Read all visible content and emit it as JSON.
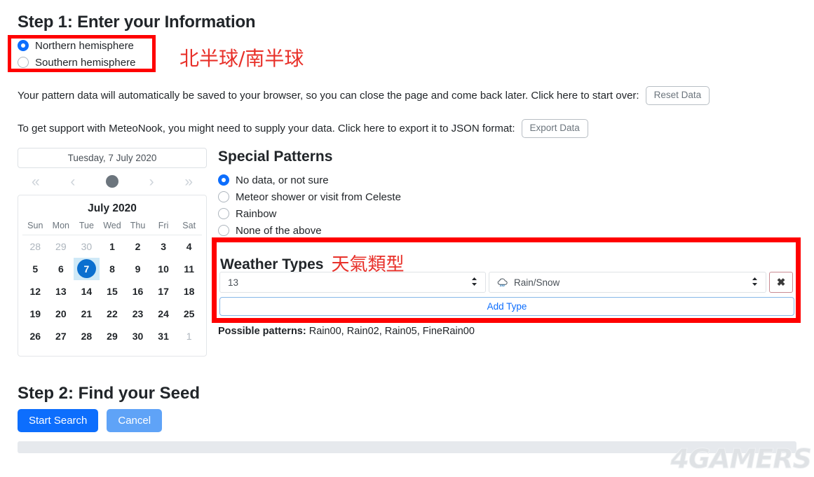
{
  "step1": {
    "title": "Step 1: Enter your Information",
    "hemisphere": {
      "options": [
        {
          "label": "Northern hemisphere",
          "selected": true
        },
        {
          "label": "Southern hemisphere",
          "selected": false
        }
      ],
      "annotation_cn": "北半球/南半球",
      "annotation_color": "#e8312a",
      "highlight_color": "#ff0000"
    },
    "save_notice": {
      "text": "Your pattern data will automatically be saved to your browser, so you can close the page and come back later. Click here to start over:",
      "button": "Reset Data"
    },
    "export_notice": {
      "text": "To get support with MeteoNook, you might need to supply your data. Click here to export it to JSON format:",
      "button": "Export Data"
    }
  },
  "calendar": {
    "selected_date_label": "Tuesday, 7 July 2020",
    "nav": {
      "prev_year_icon": "chevron-double-left",
      "prev_month_icon": "chevron-left",
      "today_icon": "circle-dot",
      "next_month_icon": "chevron-right",
      "next_year_icon": "chevron-double-right"
    },
    "month_title": "July 2020",
    "weekdays": [
      "Sun",
      "Mon",
      "Tue",
      "Wed",
      "Thu",
      "Fri",
      "Sat"
    ],
    "weeks": [
      [
        {
          "d": "28",
          "muted": true
        },
        {
          "d": "29",
          "muted": true
        },
        {
          "d": "30",
          "muted": true
        },
        {
          "d": "1"
        },
        {
          "d": "2"
        },
        {
          "d": "3"
        },
        {
          "d": "4"
        }
      ],
      [
        {
          "d": "5"
        },
        {
          "d": "6"
        },
        {
          "d": "7",
          "selected": true
        },
        {
          "d": "8"
        },
        {
          "d": "9"
        },
        {
          "d": "10"
        },
        {
          "d": "11"
        }
      ],
      [
        {
          "d": "12"
        },
        {
          "d": "13"
        },
        {
          "d": "14"
        },
        {
          "d": "15"
        },
        {
          "d": "16"
        },
        {
          "d": "17"
        },
        {
          "d": "18"
        }
      ],
      [
        {
          "d": "19"
        },
        {
          "d": "20"
        },
        {
          "d": "21"
        },
        {
          "d": "22"
        },
        {
          "d": "23"
        },
        {
          "d": "24"
        },
        {
          "d": "25"
        }
      ],
      [
        {
          "d": "26"
        },
        {
          "d": "27"
        },
        {
          "d": "28"
        },
        {
          "d": "29"
        },
        {
          "d": "30"
        },
        {
          "d": "31"
        },
        {
          "d": "1",
          "muted": true
        }
      ]
    ],
    "selected_day": "7"
  },
  "special_patterns": {
    "title": "Special Patterns",
    "options": [
      {
        "label": "No data, or not sure",
        "selected": true
      },
      {
        "label": "Meteor shower or visit from Celeste",
        "selected": false
      },
      {
        "label": "Rainbow",
        "selected": false
      },
      {
        "label": "None of the above",
        "selected": false
      }
    ]
  },
  "weather_types": {
    "title": "Weather Types",
    "annotation_cn": "天氣類型",
    "annotation_color": "#e8312a",
    "highlight_color": "#ff0000",
    "rows": [
      {
        "hour_value": "13",
        "type_value": "Rain/Snow",
        "type_icon": "cloud-rain-icon",
        "delete_label": "✖"
      }
    ],
    "add_button": "Add Type"
  },
  "possible_patterns": {
    "label": "Possible patterns:",
    "values": "Rain00, Rain02, Rain05, FineRain00"
  },
  "step2": {
    "title": "Step 2: Find your Seed",
    "start_button": "Start Search",
    "cancel_button": "Cancel",
    "progress_percent": 0
  },
  "watermark": "4GAMERS"
}
